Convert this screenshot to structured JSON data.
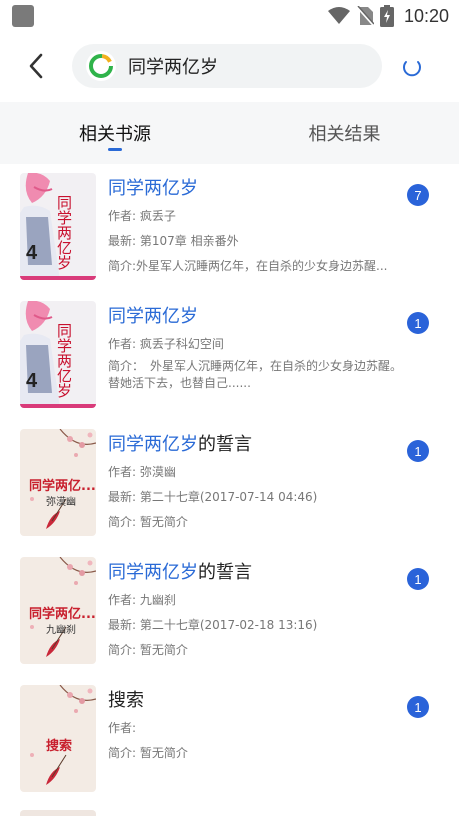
{
  "status_bar": {
    "time": "10:20"
  },
  "search": {
    "query": "同学两亿岁",
    "back_label": "back"
  },
  "tabs": [
    {
      "label": "相关书源"
    },
    {
      "label": "相关结果"
    }
  ],
  "results": [
    {
      "title_highlight": "同学两亿岁",
      "title_rest": "",
      "line1": "作者: 疯丢子",
      "line2": "最新: 第107章 相亲番外",
      "line3": "简介:外星军人沉睡两亿年，在自杀的少女身边苏醒...",
      "badge": "7",
      "cover_style": "anime"
    },
    {
      "title_highlight": "同学两亿岁",
      "title_rest": "",
      "line1": "作者: 疯丢子科幻空间",
      "intro_multiline": "简介：　外星军人沉睡两亿年，在自杀的少女身边苏醒。替她活下去，也替自己......",
      "badge": "1",
      "cover_style": "anime"
    },
    {
      "title_highlight": "同学两亿岁",
      "title_rest": "的誓言",
      "line1": "作者: 弥漠幽",
      "line2": "最新: 第二十七章(2017-07-14 04:46)",
      "line3": "简介: 暂无简介",
      "badge": "1",
      "cover_style": "plain",
      "cover_title": "同学两亿...",
      "cover_author": "弥漠幽"
    },
    {
      "title_highlight": "同学两亿岁",
      "title_rest": "的誓言",
      "line1": "作者: 九幽刹",
      "line2": "最新: 第二十七章(2017-02-18 13:16)",
      "line3": "简介: 暂无简介",
      "badge": "1",
      "cover_style": "plain",
      "cover_title": "同学两亿...",
      "cover_author": "九幽刹"
    },
    {
      "title_highlight": "",
      "title_rest": "搜索",
      "line1": "作者:",
      "line2": "简介: 暂无简介",
      "badge": "1",
      "cover_style": "plain",
      "cover_title": "搜索",
      "cover_author": ""
    }
  ],
  "colors": {
    "accent": "#2a6ad6",
    "badge": "#2a63d9",
    "cover_red": "#c8202e"
  }
}
